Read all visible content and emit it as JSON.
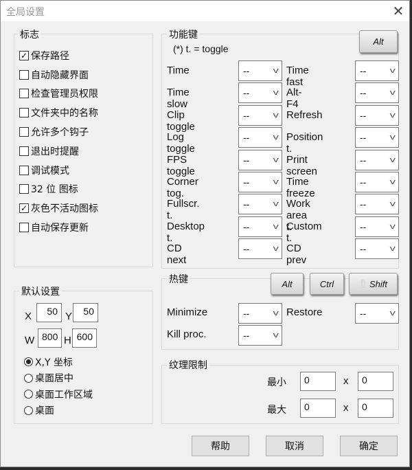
{
  "title": "全局设置",
  "flags": {
    "label": "标志",
    "items": [
      {
        "label": "保存路径",
        "checked": true
      },
      {
        "label": "自动隐藏界面",
        "checked": false
      },
      {
        "label": "检查管理员权限",
        "checked": false
      },
      {
        "label": "文件夹中的名称",
        "checked": false
      },
      {
        "label": "允许多个钩子",
        "checked": false
      },
      {
        "label": "退出时提醒",
        "checked": false
      },
      {
        "label": "调试模式",
        "checked": false
      },
      {
        "label": "32 位 图标",
        "checked": false
      },
      {
        "label": "灰色不活动图标",
        "checked": true
      },
      {
        "label": "自动保存更新",
        "checked": false
      }
    ]
  },
  "defaults": {
    "label": "默认设置",
    "x_label": "X",
    "x": "50",
    "y_label": "Y",
    "y": "50",
    "w_label": "W",
    "w": "800",
    "h_label": "H",
    "h": "600",
    "radios": [
      {
        "label": "X,Y 坐标",
        "selected": true
      },
      {
        "label": "桌面居中",
        "selected": false
      },
      {
        "label": "桌面工作区域",
        "selected": false
      },
      {
        "label": "桌面",
        "selected": false
      }
    ]
  },
  "function_keys": {
    "label": "功能键",
    "note": "(*) t.  = toggle",
    "modifier": "Alt",
    "rows": [
      {
        "left": "Time",
        "lv": "--",
        "right": "Time fast",
        "rv": "--"
      },
      {
        "left": "Time slow",
        "lv": "--",
        "right": "Alt-F4",
        "rv": "--"
      },
      {
        "left": "Clip toggle",
        "lv": "--",
        "right": "Refresh",
        "rv": "--"
      },
      {
        "left": "Log toggle",
        "lv": "--",
        "right": "Position t.",
        "rv": "--"
      },
      {
        "left": "FPS toggle",
        "lv": "--",
        "right": "Print screen",
        "rv": "--"
      },
      {
        "left": "Corner tog.",
        "lv": "--",
        "right": "Time freeze",
        "rv": "--"
      },
      {
        "left": "Fullscr. t.",
        "lv": "--",
        "right": "Work area t.",
        "rv": "--"
      },
      {
        "left": "Desktop t.",
        "lv": "--",
        "right": "Custom t.",
        "rv": "--"
      },
      {
        "left": "CD next",
        "lv": "--",
        "right": "CD prev",
        "rv": "--"
      }
    ]
  },
  "hotkeys": {
    "label": "热键",
    "alt": "Alt",
    "ctrl": "Ctrl",
    "shift": "Shift",
    "minimize": "Minimize",
    "minimize_v": "--",
    "restore": "Restore",
    "restore_v": "--",
    "kill": "Kill proc.",
    "kill_v": "--"
  },
  "texture": {
    "label": "纹理限制",
    "min": "最小",
    "max": "最大",
    "x": "x",
    "min_w": "0",
    "min_h": "0",
    "max_w": "0",
    "max_h": "0"
  },
  "buttons": {
    "help": "帮助",
    "cancel": "取消",
    "ok": "确定"
  }
}
